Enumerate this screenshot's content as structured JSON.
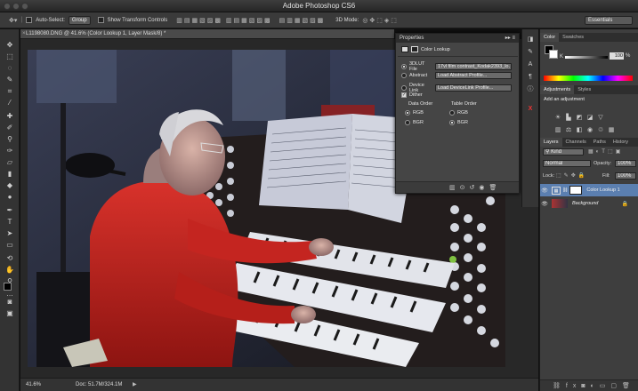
{
  "app": {
    "title": "Adobe Photoshop CS6"
  },
  "options_bar": {
    "auto_select_label": "Auto-Select:",
    "auto_select_value": "Group",
    "show_transform_label": "Show Transform Controls",
    "mode_3d_label": "3D Mode:",
    "workspace": "Essentials"
  },
  "document": {
    "tab_title": "L1198080.DNG @ 41.6% (Color Lookup 1, Layer Mask/8) *",
    "zoom": "41.6%",
    "doc_size": "Doc: 51.7M/324.1M"
  },
  "properties": {
    "panel_title": "Properties",
    "adjustment_name": "Color Lookup",
    "options": [
      {
        "label": "3DLUT File",
        "value": "17vl film contrast_Kodak2393_lo…",
        "checked": true
      },
      {
        "label": "Abstract",
        "value": "Load Abstract Profile...",
        "checked": false
      },
      {
        "label": "Device Link",
        "value": "Load DeviceLink Profile...",
        "checked": false
      }
    ],
    "dither_label": "Dither",
    "data_order_label": "Data Order",
    "table_order_label": "Table Order",
    "rgb": "RGB",
    "bgr": "BGR"
  },
  "color_panel": {
    "tabs": [
      "Color",
      "Swatches"
    ],
    "k_label": "K",
    "k_value": "100",
    "k_unit": "%"
  },
  "adjustments_panel": {
    "tabs": [
      "Adjustments",
      "Styles"
    ],
    "add_label": "Add an adjustment"
  },
  "layers_panel": {
    "tabs": [
      "Layers",
      "Channels",
      "Paths",
      "History"
    ],
    "kind_label": "Kind",
    "blend_mode": "Normal",
    "opacity_label": "Opacity:",
    "opacity_value": "100%",
    "lock_label": "Lock:",
    "fill_label": "Fill:",
    "fill_value": "100%",
    "layers": [
      {
        "name": "Color Lookup 1"
      },
      {
        "name": "Background"
      }
    ]
  },
  "colors": {
    "accent": "#2f6fbf",
    "panel": "#454545"
  }
}
